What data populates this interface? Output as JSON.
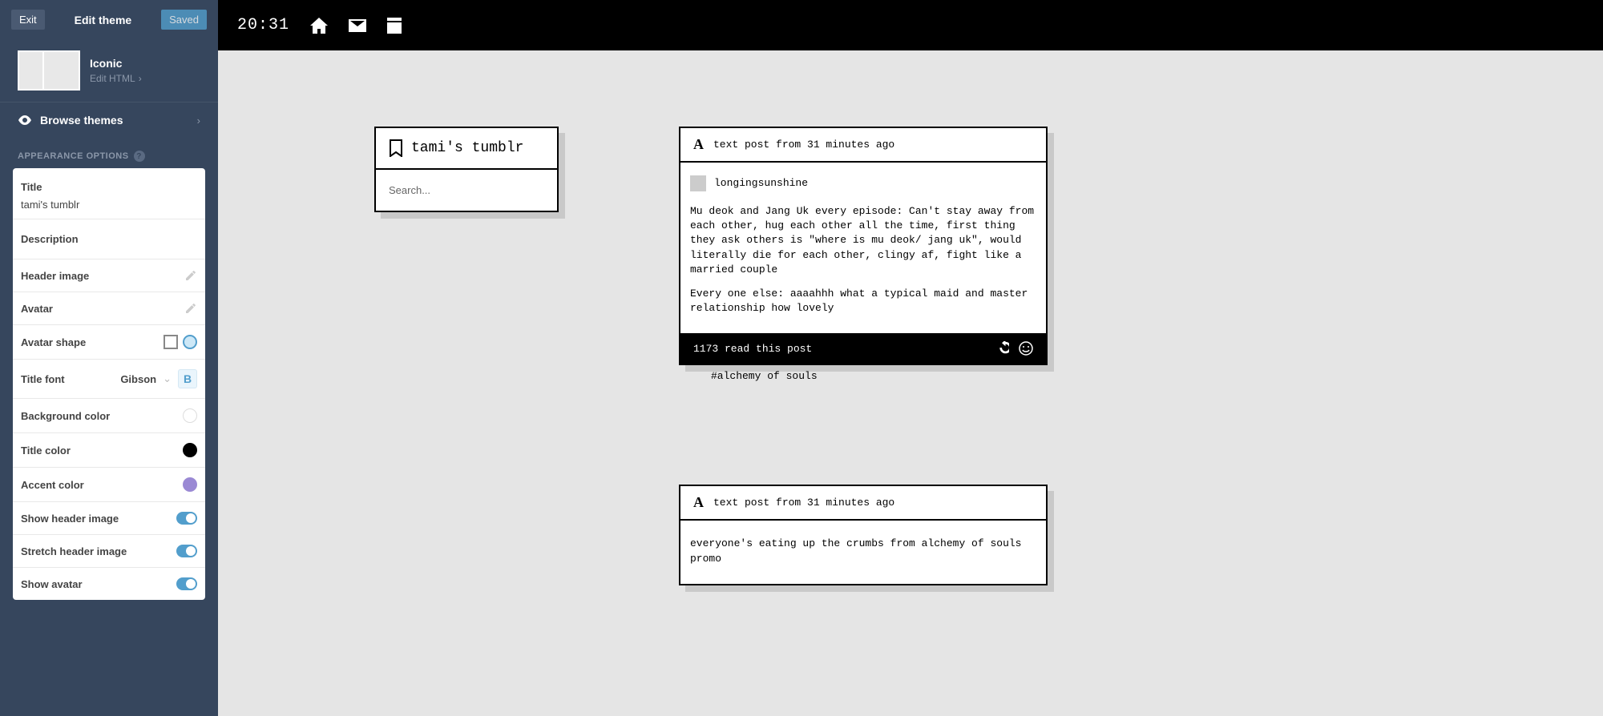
{
  "sidebar": {
    "exit": "Exit",
    "title": "Edit theme",
    "saved": "Saved",
    "theme_name": "Iconic",
    "edit_html": "Edit HTML",
    "browse": "Browse themes",
    "section": "APPEARANCE OPTIONS",
    "options": {
      "title_label": "Title",
      "title_value": "tami's tumblr",
      "description_label": "Description",
      "header_image": "Header image",
      "avatar": "Avatar",
      "avatar_shape": "Avatar shape",
      "title_font": "Title font",
      "font_value": "Gibson",
      "bg_color": "Background color",
      "title_color": "Title color",
      "accent_color": "Accent color",
      "show_header": "Show header image",
      "stretch_header": "Stretch header image",
      "show_avatar": "Show avatar"
    }
  },
  "preview": {
    "clock": "20:31",
    "blog_title": "tami's tumblr",
    "search_placeholder": "Search...",
    "posts": [
      {
        "meta": "text post from 31 minutes ago",
        "reblog_user": "longingsunshine",
        "p1": "Mu deok and Jang Uk every episode: Can't stay away from each other, hug each other all the time, first thing they ask others is \"where is mu deok/ jang uk\", would literally die for each other, clingy af, fight like a married couple",
        "p2": "Every one else: aaaahhh what a typical maid and master relationship how lovely",
        "notes": "1173 read this post",
        "tags": "#alchemy of souls"
      },
      {
        "meta": "text post from 31 minutes ago",
        "p1": "everyone's eating up the crumbs from alchemy of souls promo"
      }
    ]
  },
  "colors": {
    "accent": "#529ecc",
    "purple": "#9a89d4"
  }
}
